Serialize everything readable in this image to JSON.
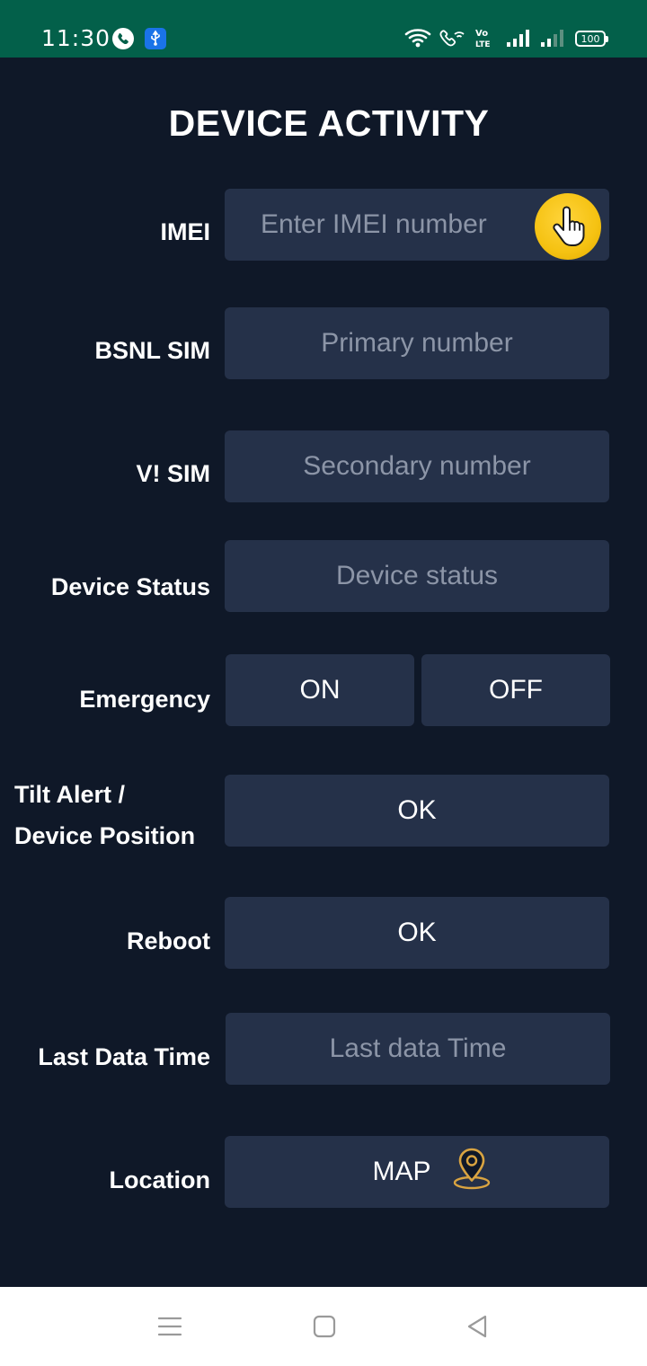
{
  "status_bar": {
    "time": "11:30",
    "battery": "100",
    "background": "#03604a",
    "icons": [
      "call-icon",
      "usb-icon",
      "wifi-icon",
      "wifi-call-icon",
      "volte-icon",
      "signal-icon",
      "signal-icon"
    ]
  },
  "title": "DEVICE ACTIVITY",
  "rows": {
    "imei": {
      "label": "IMEI",
      "placeholder": "Enter IMEI number"
    },
    "bsnl": {
      "label": "BSNL SIM",
      "placeholder": "Primary number"
    },
    "vi": {
      "label": "V! SIM",
      "placeholder": "Secondary number"
    },
    "device_status": {
      "label": "Device Status",
      "placeholder": "Device status"
    },
    "emergency": {
      "label": "Emergency",
      "on_label": "ON",
      "off_label": "OFF"
    },
    "tilt": {
      "label_line1": "Tilt Alert /",
      "label_line2": "Device Position",
      "button": "OK"
    },
    "reboot": {
      "label": "Reboot",
      "button": "OK"
    },
    "last_data": {
      "label": "Last Data Time",
      "placeholder": "Last data Time"
    },
    "location": {
      "label": "Location",
      "button": "MAP",
      "icon": "map-pin-icon"
    }
  },
  "colors": {
    "background": "#0f1828",
    "field": "#253149",
    "placeholder": "#8c95a7",
    "accent": "#f5c212"
  },
  "nav_bar": {
    "icons": [
      "menu-icon",
      "home-icon",
      "back-icon"
    ]
  }
}
